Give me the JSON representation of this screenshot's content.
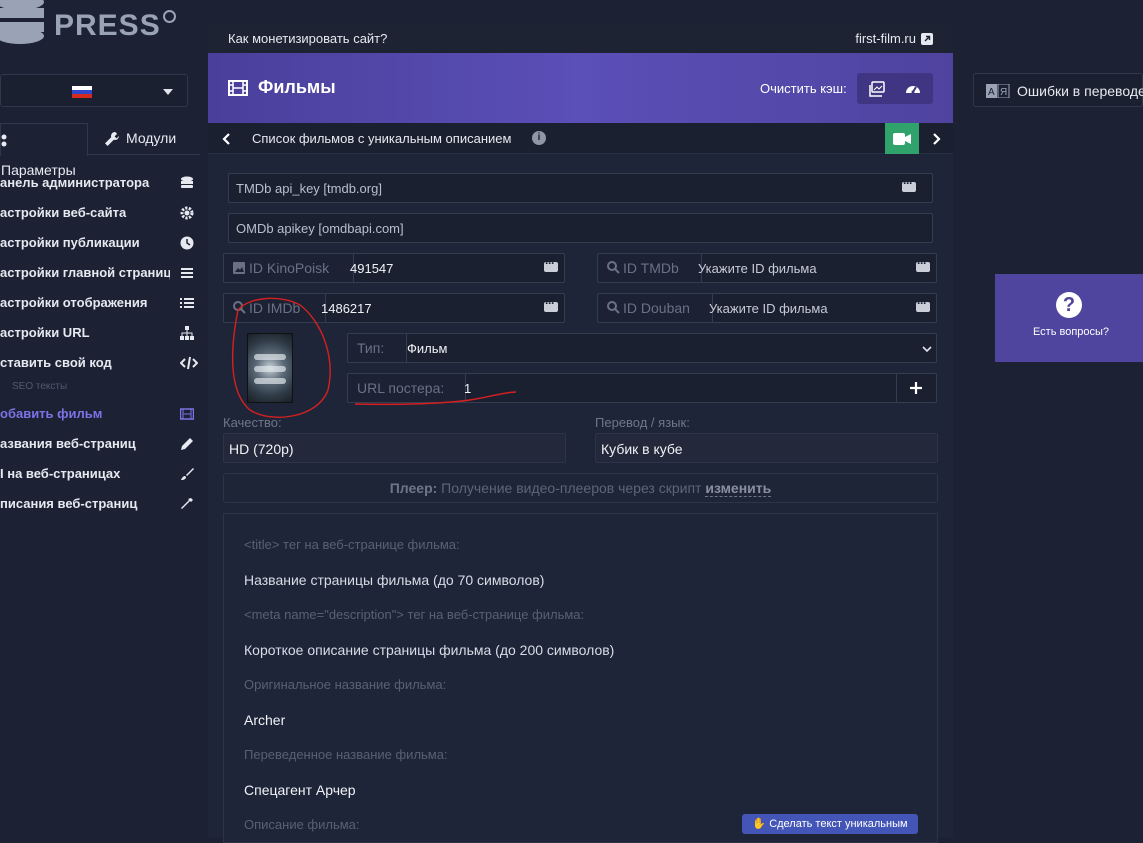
{
  "logo": {
    "top_text": "cinema",
    "main_text": "PRESS"
  },
  "sidebar": {
    "tabs": [
      {
        "label": "Параметры"
      },
      {
        "label": "Модули"
      }
    ],
    "items": [
      {
        "label": "анель администратора",
        "icon": "database-icon"
      },
      {
        "label": "астройки веб-сайта",
        "icon": "gear-icon"
      },
      {
        "label": "астройки публикации",
        "icon": "clock-icon"
      },
      {
        "label": "астройки главной страницы",
        "icon": "list-icon"
      },
      {
        "label": "астройки отображения",
        "icon": "list-ul-icon"
      },
      {
        "label": "астройки URL",
        "icon": "sitemap-icon"
      },
      {
        "label": "ставить свой код",
        "icon": "code-icon"
      },
      {
        "label": "обавить фильм",
        "icon": "film-icon"
      },
      {
        "label": "азвания веб-страниц",
        "icon": "pencil-icon"
      },
      {
        "label": "I на веб-страницах",
        "icon": "brush-icon"
      },
      {
        "label": "писания веб-страниц",
        "icon": "eyedropper-icon"
      }
    ],
    "separator": "SEO тексты"
  },
  "topbar": {
    "left": "Как монетизировать сайт?",
    "right": "first-film.ru"
  },
  "header": {
    "title": "Фильмы",
    "cache_label": "Очистить кэш:"
  },
  "subbar": {
    "title": "Список фильмов с уникальным описанием"
  },
  "fields": {
    "tmdb_key": {
      "placeholder": "TMDb api_key [tmdb.org]"
    },
    "omdb_key": {
      "placeholder": "OMDb apikey [omdbapi.com]"
    },
    "kp": {
      "prefix": "ID KinoPoisk",
      "value": "491547"
    },
    "tmdb_id": {
      "prefix": "ID TMDb",
      "placeholder": "Укажите ID фильма"
    },
    "imdb": {
      "prefix": "ID IMDb",
      "value": "1486217"
    },
    "douban": {
      "prefix": "ID Douban",
      "placeholder": "Укажите ID фильма"
    },
    "type": {
      "label": "Тип:",
      "value": "Фильм"
    },
    "poster_url": {
      "label": "URL постера:",
      "value": "1"
    },
    "quality": {
      "label": "Качество:",
      "value": "HD (720p)"
    },
    "translation": {
      "label": "Перевод / язык:",
      "value": "Кубик в кубе"
    }
  },
  "player": {
    "bold": "Плеер:",
    "text": " Получение видео-плееров через скрипт ",
    "link": "изменить"
  },
  "seo": {
    "title_label": "<title> тег на веб-странице фильма:",
    "title_placeholder": "Название страницы фильма (до 70 символов)",
    "desc_label": "<meta name=\"description\"> тег на веб-странице фильма:",
    "desc_placeholder": "Короткое описание страницы фильма (до 200 символов)",
    "orig_label": "Оригинальное название фильма:",
    "orig_value": "Archer",
    "trans_label": "Переведенное название фильма:",
    "trans_value": "Спецагент Арчер",
    "plot_label": "Описание фильма:",
    "unique_button": "Сделать текст уникальным"
  },
  "right": {
    "translate_button": "Ошибки в переводе?",
    "help": "Есть вопросы?"
  },
  "colors": {
    "accent": "#5b4fb8",
    "green": "#2fa36b",
    "active_item": "#7d72e6",
    "annotation": "#d62020"
  }
}
